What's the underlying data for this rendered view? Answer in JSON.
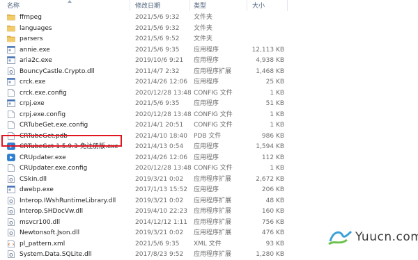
{
  "header": {
    "name": "名称",
    "date": "修改日期",
    "type": "类型",
    "size": "大小"
  },
  "files": [
    {
      "name": "ffmpeg",
      "date": "2021/5/6 9:32",
      "type": "文件夹",
      "size": "",
      "icon": "folder-icon"
    },
    {
      "name": "languages",
      "date": "2021/5/6 9:32",
      "type": "文件夹",
      "size": "",
      "icon": "folder-icon"
    },
    {
      "name": "parsers",
      "date": "2021/5/6 9:52",
      "type": "文件夹",
      "size": "",
      "icon": "folder-icon"
    },
    {
      "name": "annie.exe",
      "date": "2021/5/6 9:35",
      "type": "应用程序",
      "size": "12,113 KB",
      "icon": "exe-icon"
    },
    {
      "name": "aria2c.exe",
      "date": "2019/10/6 9:21",
      "type": "应用程序",
      "size": "4,938 KB",
      "icon": "exe-icon"
    },
    {
      "name": "BouncyCastle.Crypto.dll",
      "date": "2011/4/7 2:32",
      "type": "应用程序扩展",
      "size": "1,468 KB",
      "icon": "dll-icon"
    },
    {
      "name": "crck.exe",
      "date": "2021/4/26 12:06",
      "type": "应用程序",
      "size": "25 KB",
      "icon": "exe-icon"
    },
    {
      "name": "crck.exe.config",
      "date": "2020/12/28 13:48",
      "type": "CONFIG 文件",
      "size": "1 KB",
      "icon": "file-icon"
    },
    {
      "name": "crpj.exe",
      "date": "2021/5/6 9:35",
      "type": "应用程序",
      "size": "51 KB",
      "icon": "exe-icon"
    },
    {
      "name": "crpj.exe.config",
      "date": "2020/12/28 13:48",
      "type": "CONFIG 文件",
      "size": "1 KB",
      "icon": "file-icon"
    },
    {
      "name": "CRTubeGet.exe.config",
      "date": "2021/4/1 20:51",
      "type": "CONFIG 文件",
      "size": "1 KB",
      "icon": "file-icon"
    },
    {
      "name": "CRTubeGet.pdb",
      "date": "2021/4/10 18:40",
      "type": "PDB 文件",
      "size": "986 KB",
      "icon": "file-icon"
    },
    {
      "name": "CRTubeGet-1.5.9.3-免注册版.exe",
      "date": "2021/4/13 0:54",
      "type": "应用程序",
      "size": "1,594 KB",
      "icon": "app-icon"
    },
    {
      "name": "CRUpdater.exe",
      "date": "2021/4/26 12:06",
      "type": "应用程序",
      "size": "112 KB",
      "icon": "app-icon"
    },
    {
      "name": "CRUpdater.exe.config",
      "date": "2020/12/28 13:48",
      "type": "CONFIG 文件",
      "size": "1 KB",
      "icon": "file-icon"
    },
    {
      "name": "CSkin.dll",
      "date": "2019/3/21 0:02",
      "type": "应用程序扩展",
      "size": "2,672 KB",
      "icon": "dll-icon"
    },
    {
      "name": "dwebp.exe",
      "date": "2017/1/13 15:52",
      "type": "应用程序",
      "size": "206 KB",
      "icon": "exe-icon"
    },
    {
      "name": "Interop.IWshRuntimeLibrary.dll",
      "date": "2019/3/21 0:02",
      "type": "应用程序扩展",
      "size": "48 KB",
      "icon": "dll-icon"
    },
    {
      "name": "Interop.SHDocVw.dll",
      "date": "2019/4/10 22:23",
      "type": "应用程序扩展",
      "size": "160 KB",
      "icon": "dll-icon"
    },
    {
      "name": "msvcr100.dll",
      "date": "2014/12/12 1:11",
      "type": "应用程序扩展",
      "size": "756 KB",
      "icon": "dll-icon"
    },
    {
      "name": "Newtonsoft.Json.dll",
      "date": "2019/3/21 0:02",
      "type": "应用程序扩展",
      "size": "476 KB",
      "icon": "dll-icon"
    },
    {
      "name": "pl_pattern.xml",
      "date": "2021/5/6 9:35",
      "type": "XML 文件",
      "size": "93 KB",
      "icon": "xml-icon"
    },
    {
      "name": "System.Data.SQLite.dll",
      "date": "2017/8/23 9:52",
      "type": "应用程序扩展",
      "size": "1,280 KB",
      "icon": "dll-icon"
    }
  ],
  "watermark": "Yuucn.com",
  "colors": {
    "highlight": "#e0141e",
    "folder": "#e8b84a",
    "header_text": "#4c607a"
  }
}
